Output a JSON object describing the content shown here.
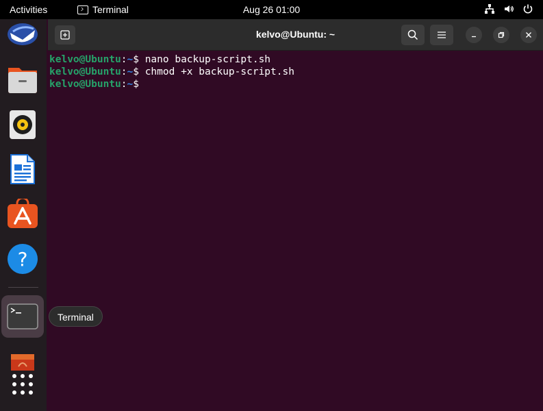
{
  "topbar": {
    "activities": "Activities",
    "app_name": "Terminal",
    "clock": "Aug 26  01:00"
  },
  "dock": {
    "tooltip": "Terminal",
    "items": [
      "thunderbird-icon",
      "files-icon",
      "rhythmbox-icon",
      "writer-icon",
      "app-center-icon",
      "help-icon",
      "terminal-icon",
      "dock-app-icon",
      "show-apps-icon"
    ]
  },
  "window": {
    "title": "kelvo@Ubuntu: ~"
  },
  "terminal": {
    "lines": [
      {
        "user": "kelvo@Ubuntu",
        "colon": ":",
        "path": "~",
        "prompt": "$ ",
        "cmd": "nano backup-script.sh"
      },
      {
        "user": "kelvo@Ubuntu",
        "colon": ":",
        "path": "~",
        "prompt": "$ ",
        "cmd": "chmod +x backup-script.sh"
      },
      {
        "user": "kelvo@Ubuntu",
        "colon": ":",
        "path": "~",
        "prompt": "$ ",
        "cmd": ""
      }
    ]
  },
  "colors": {
    "terminal_bg": "#300a24",
    "prompt_user": "#26a269",
    "prompt_path": "#3584e4",
    "accent": "#e95420"
  }
}
